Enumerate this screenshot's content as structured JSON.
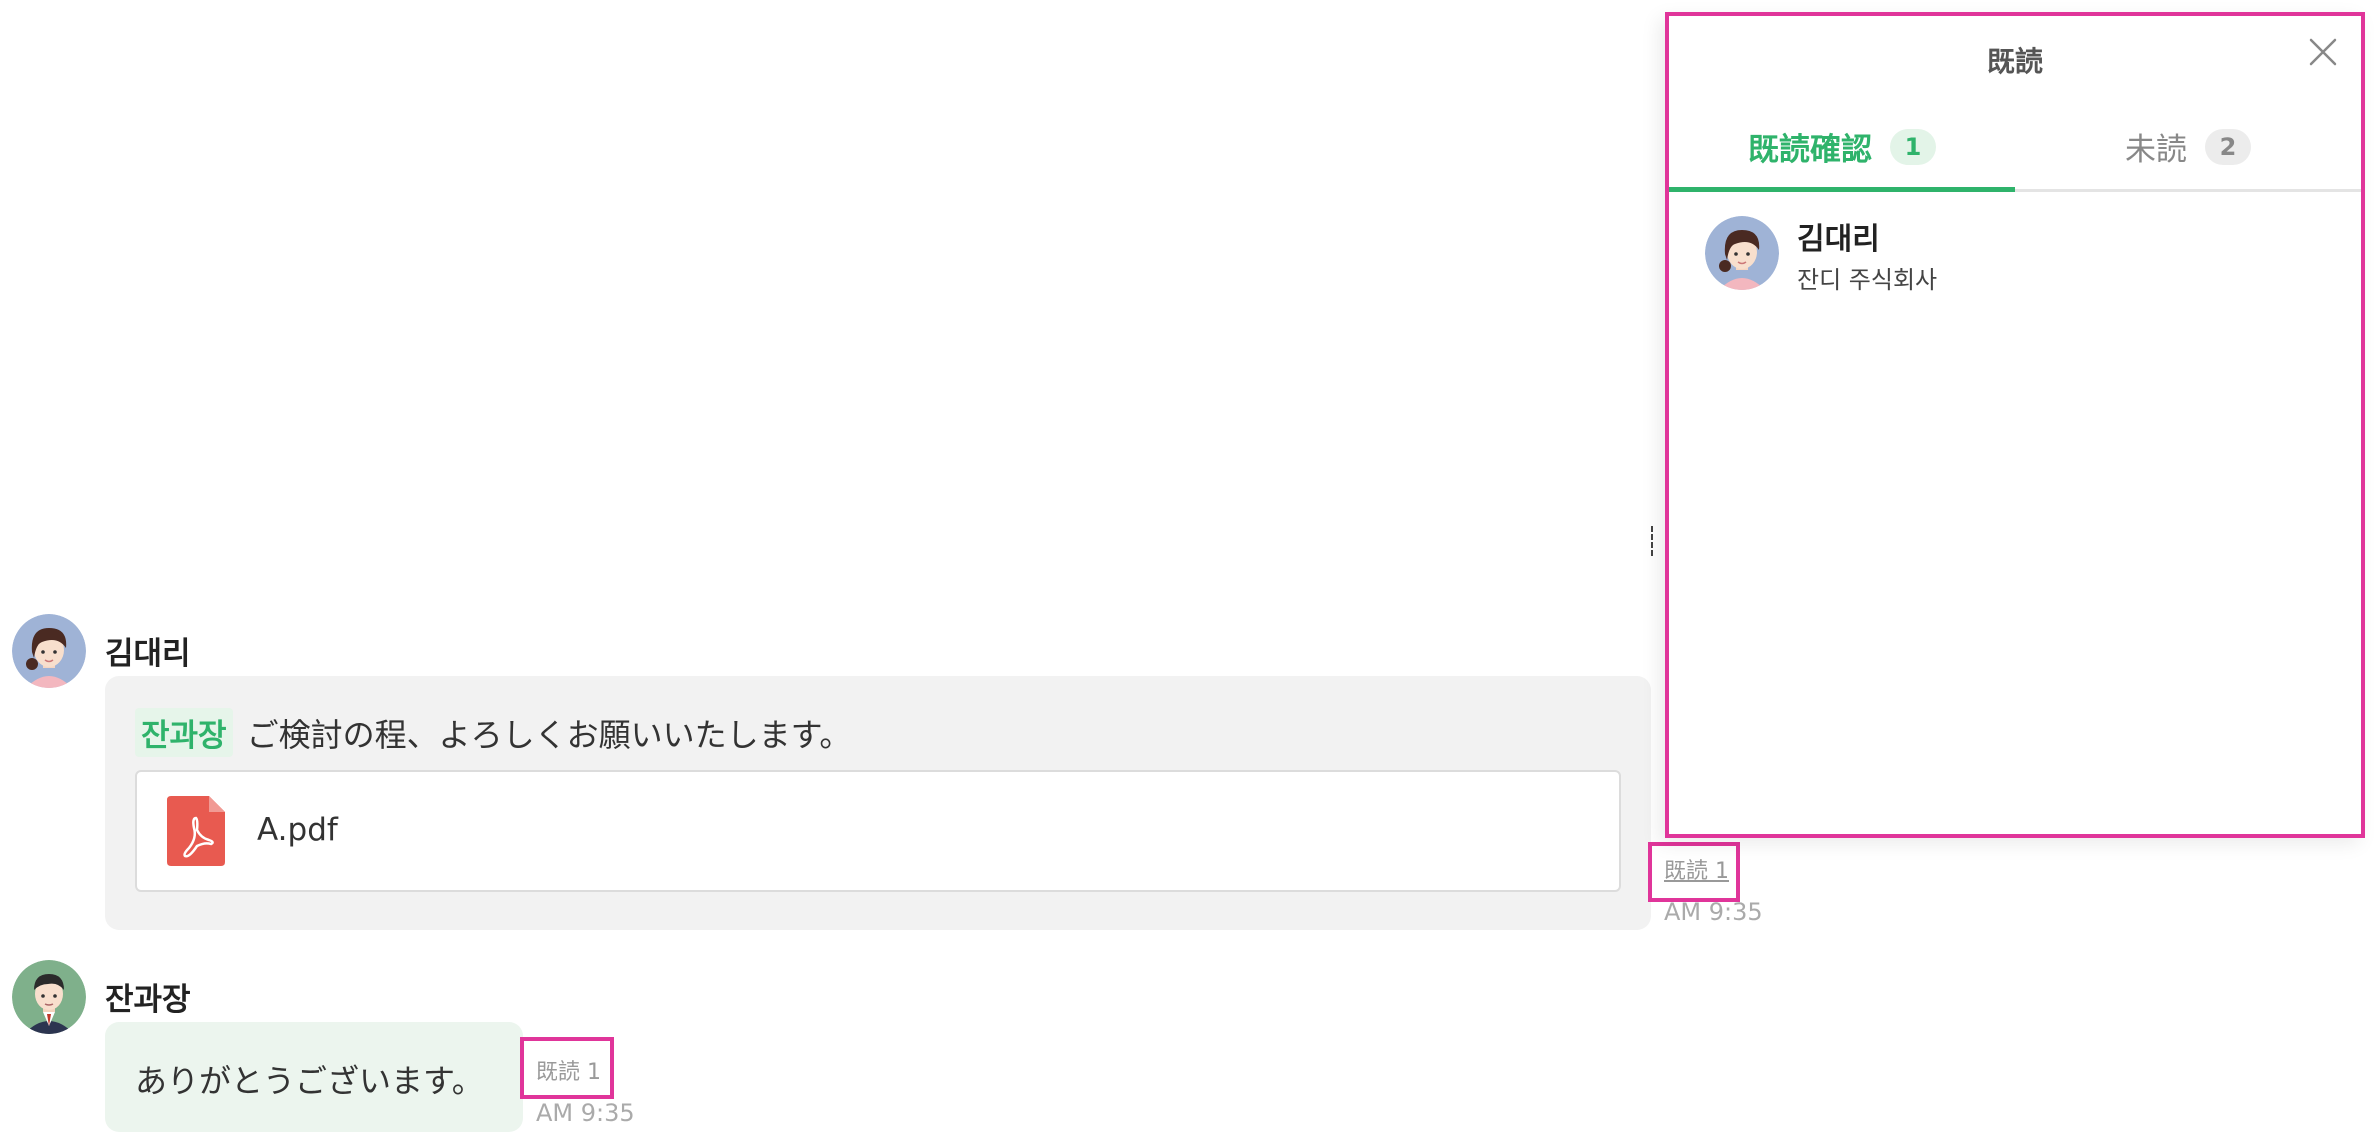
{
  "panel": {
    "title": "既読",
    "tabs": [
      {
        "label": "既読確認",
        "count": "1"
      },
      {
        "label": "未読",
        "count": "2"
      }
    ],
    "readers": [
      {
        "name": "김대리",
        "company": "잔디 주식회사"
      }
    ]
  },
  "messages": [
    {
      "sender": "김대리",
      "mention": "잔과장",
      "text": "ご検討の程、よろしくお願いいたします。",
      "file": {
        "name": "A.pdf",
        "icon": "pdf-icon"
      },
      "read_status": "既読 1",
      "time": "AM 9:35"
    },
    {
      "sender": "잔과장",
      "text": "ありがとうございます。",
      "read_status": "既読 1",
      "time": "AM 9:35"
    }
  ],
  "colors": {
    "accent_green": "#2fb36b",
    "highlight_magenta": "#e0359a",
    "pdf_red": "#e85a50"
  }
}
